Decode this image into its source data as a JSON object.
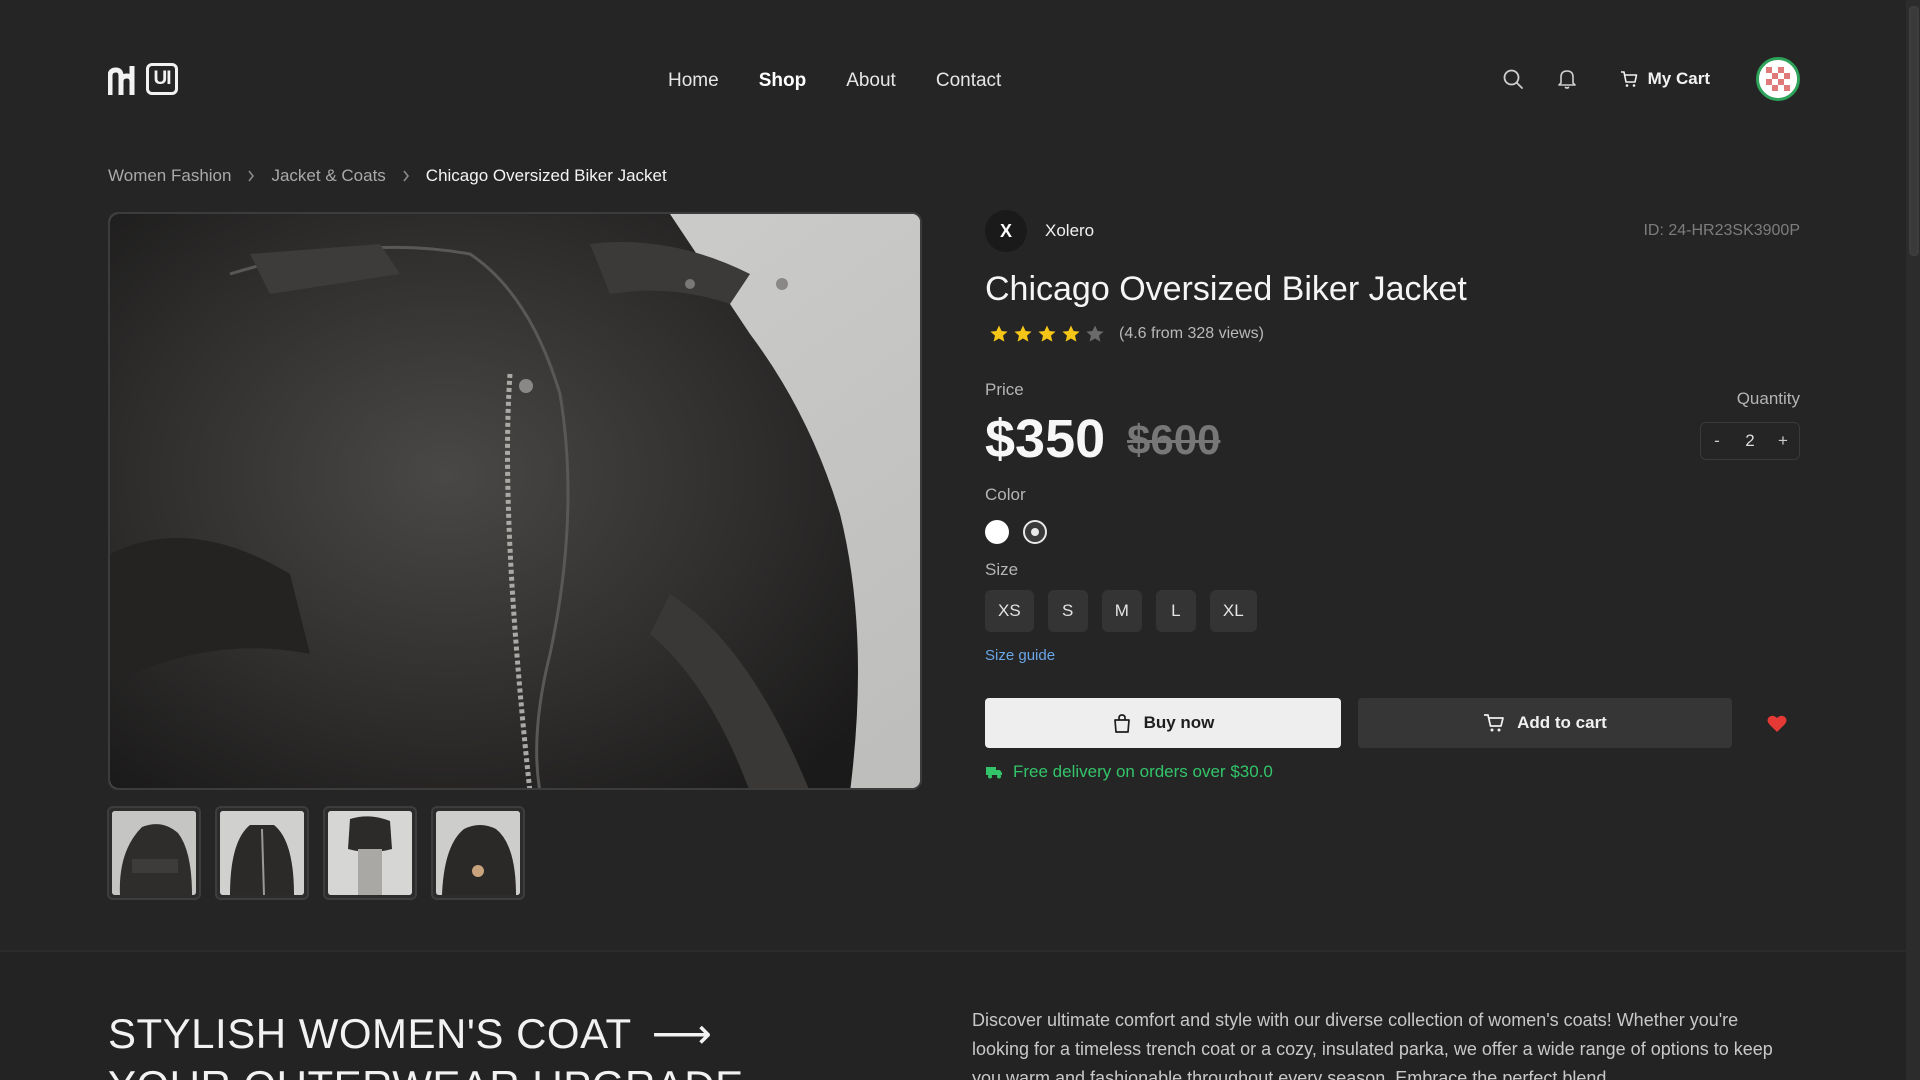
{
  "header": {
    "logo_text": "UI",
    "nav": [
      {
        "label": "Home",
        "active": false
      },
      {
        "label": "Shop",
        "active": true
      },
      {
        "label": "About",
        "active": false
      },
      {
        "label": "Contact",
        "active": false
      }
    ],
    "icons": {
      "search": "search-icon",
      "notifications": "bell-icon",
      "cart": "cart-icon"
    },
    "cart_label": "My Cart"
  },
  "breadcrumb": [
    "Women Fashion",
    "Jacket & Coats",
    "Chicago Oversized Biker Jacket"
  ],
  "gallery": {
    "thumbnail_count": 4
  },
  "product": {
    "brand_initial": "X",
    "brand_name": "Xolero",
    "id": "ID: 24-HR23SK3900P",
    "title": "Chicago Oversized Biker Jacket",
    "rating_value": 4,
    "rating_max": 5,
    "rating_text": "(4.6 from 328 views)",
    "price_label": "Price",
    "price": "$350",
    "original_price": "$600",
    "quantity_label": "Quantity",
    "quantity": "2",
    "qty_minus": "-",
    "qty_plus": "+",
    "color_label": "Color",
    "colors": [
      "#ffffff",
      "#3a3a3a"
    ],
    "size_label": "Size",
    "sizes": [
      "XS",
      "S",
      "M",
      "L",
      "XL"
    ],
    "size_guide": "Size guide",
    "buy_now": "Buy now",
    "add_to_cart": "Add to cart",
    "delivery_note": "Free delivery on orders over $30.0"
  },
  "colors": {
    "background": "#252525",
    "accent_green": "#33c46a",
    "link_blue": "#6aa7e8",
    "favorite_red": "#e53935",
    "star_yellow": "#f5c518"
  },
  "promo": {
    "headline_line1": "STYLISH WOMEN'S COAT",
    "headline_arrow": "⟶",
    "headline_line2": "YOUR OUTERWEAR UPGRADE",
    "description": "Discover ultimate comfort and style with our diverse collection of women's coats! Whether you're looking for a timeless trench coat or a cozy, insulated parka, we offer a wide range of options to keep you warm and fashionable throughout every season. Embrace the perfect blend"
  }
}
